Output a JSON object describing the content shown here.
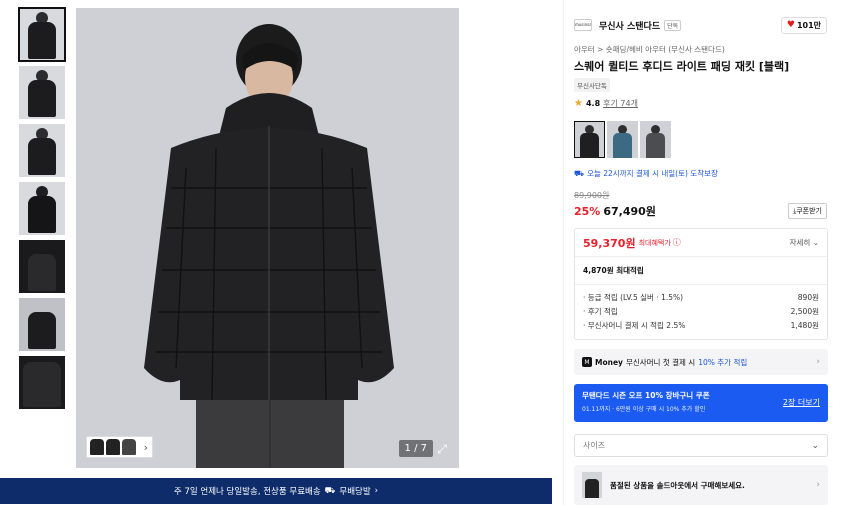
{
  "gallery": {
    "thumbnails": [
      "thumb-1",
      "thumb-2",
      "thumb-3",
      "thumb-4",
      "thumb-5",
      "thumb-6",
      "thumb-7"
    ],
    "counter": "1 / 7",
    "expand_icon": "expand-icon",
    "strip_chevron": "›"
  },
  "shipping_banner": {
    "text": "주 7일 언제나 당일발송, 전상품 무료배송",
    "badge": "무배당발",
    "chevron": "›"
  },
  "brand": {
    "logo": "musinsa standard",
    "name": "무신사 스탠다드",
    "badge": "단독",
    "likes": "101만"
  },
  "product": {
    "breadcrumb": "아우터 > 숏패딩/헤비 아우터 (무신사 스탠다드)",
    "title": "스퀘어 퀼티드 후디드 라이트 패딩 재킷 [블랙]",
    "exclusive_badge": "무신사단독",
    "rating": "4.8",
    "reviews": "후기 74개",
    "colors": [
      "#1f1f21",
      "#3d6a83",
      "#4c4d50"
    ],
    "delivery": "오늘 22시까지 결제 시 내일(토) 도착보장",
    "original_price": "89,900원",
    "discount": "25%",
    "price": "67,490원",
    "coupon_button": "쿠폰받기"
  },
  "benefits": {
    "max_price": "59,370원",
    "max_label": "최대혜택가",
    "detail_toggle": "자세히",
    "points_total": "4,870원 최대적립",
    "rows": [
      {
        "label": "· 등급 적립 (LV.5 실버 · 1.5%)",
        "value": "890원"
      },
      {
        "label": "· 후기 적립",
        "value": "2,500원"
      },
      {
        "label": "· 무신사머니 결제 시 적립 2.5%",
        "value": "1,480원"
      }
    ]
  },
  "money": {
    "logo": "M",
    "brand": "Money",
    "text": "무신사머니 첫 결제 시",
    "highlight": "10% 추가 적립"
  },
  "coupon_banner": {
    "title": "무탠다드 시즌 오프 10% 장바구니 쿠폰",
    "subtitle": "01.11까지 · 6만원 이상 구매 시 10% 추가 할인",
    "link": "2장 더보기"
  },
  "size": {
    "placeholder": "사이즈"
  },
  "soldout": {
    "text": "품절된 상품을 솔드아웃에서 구매해보세요."
  }
}
